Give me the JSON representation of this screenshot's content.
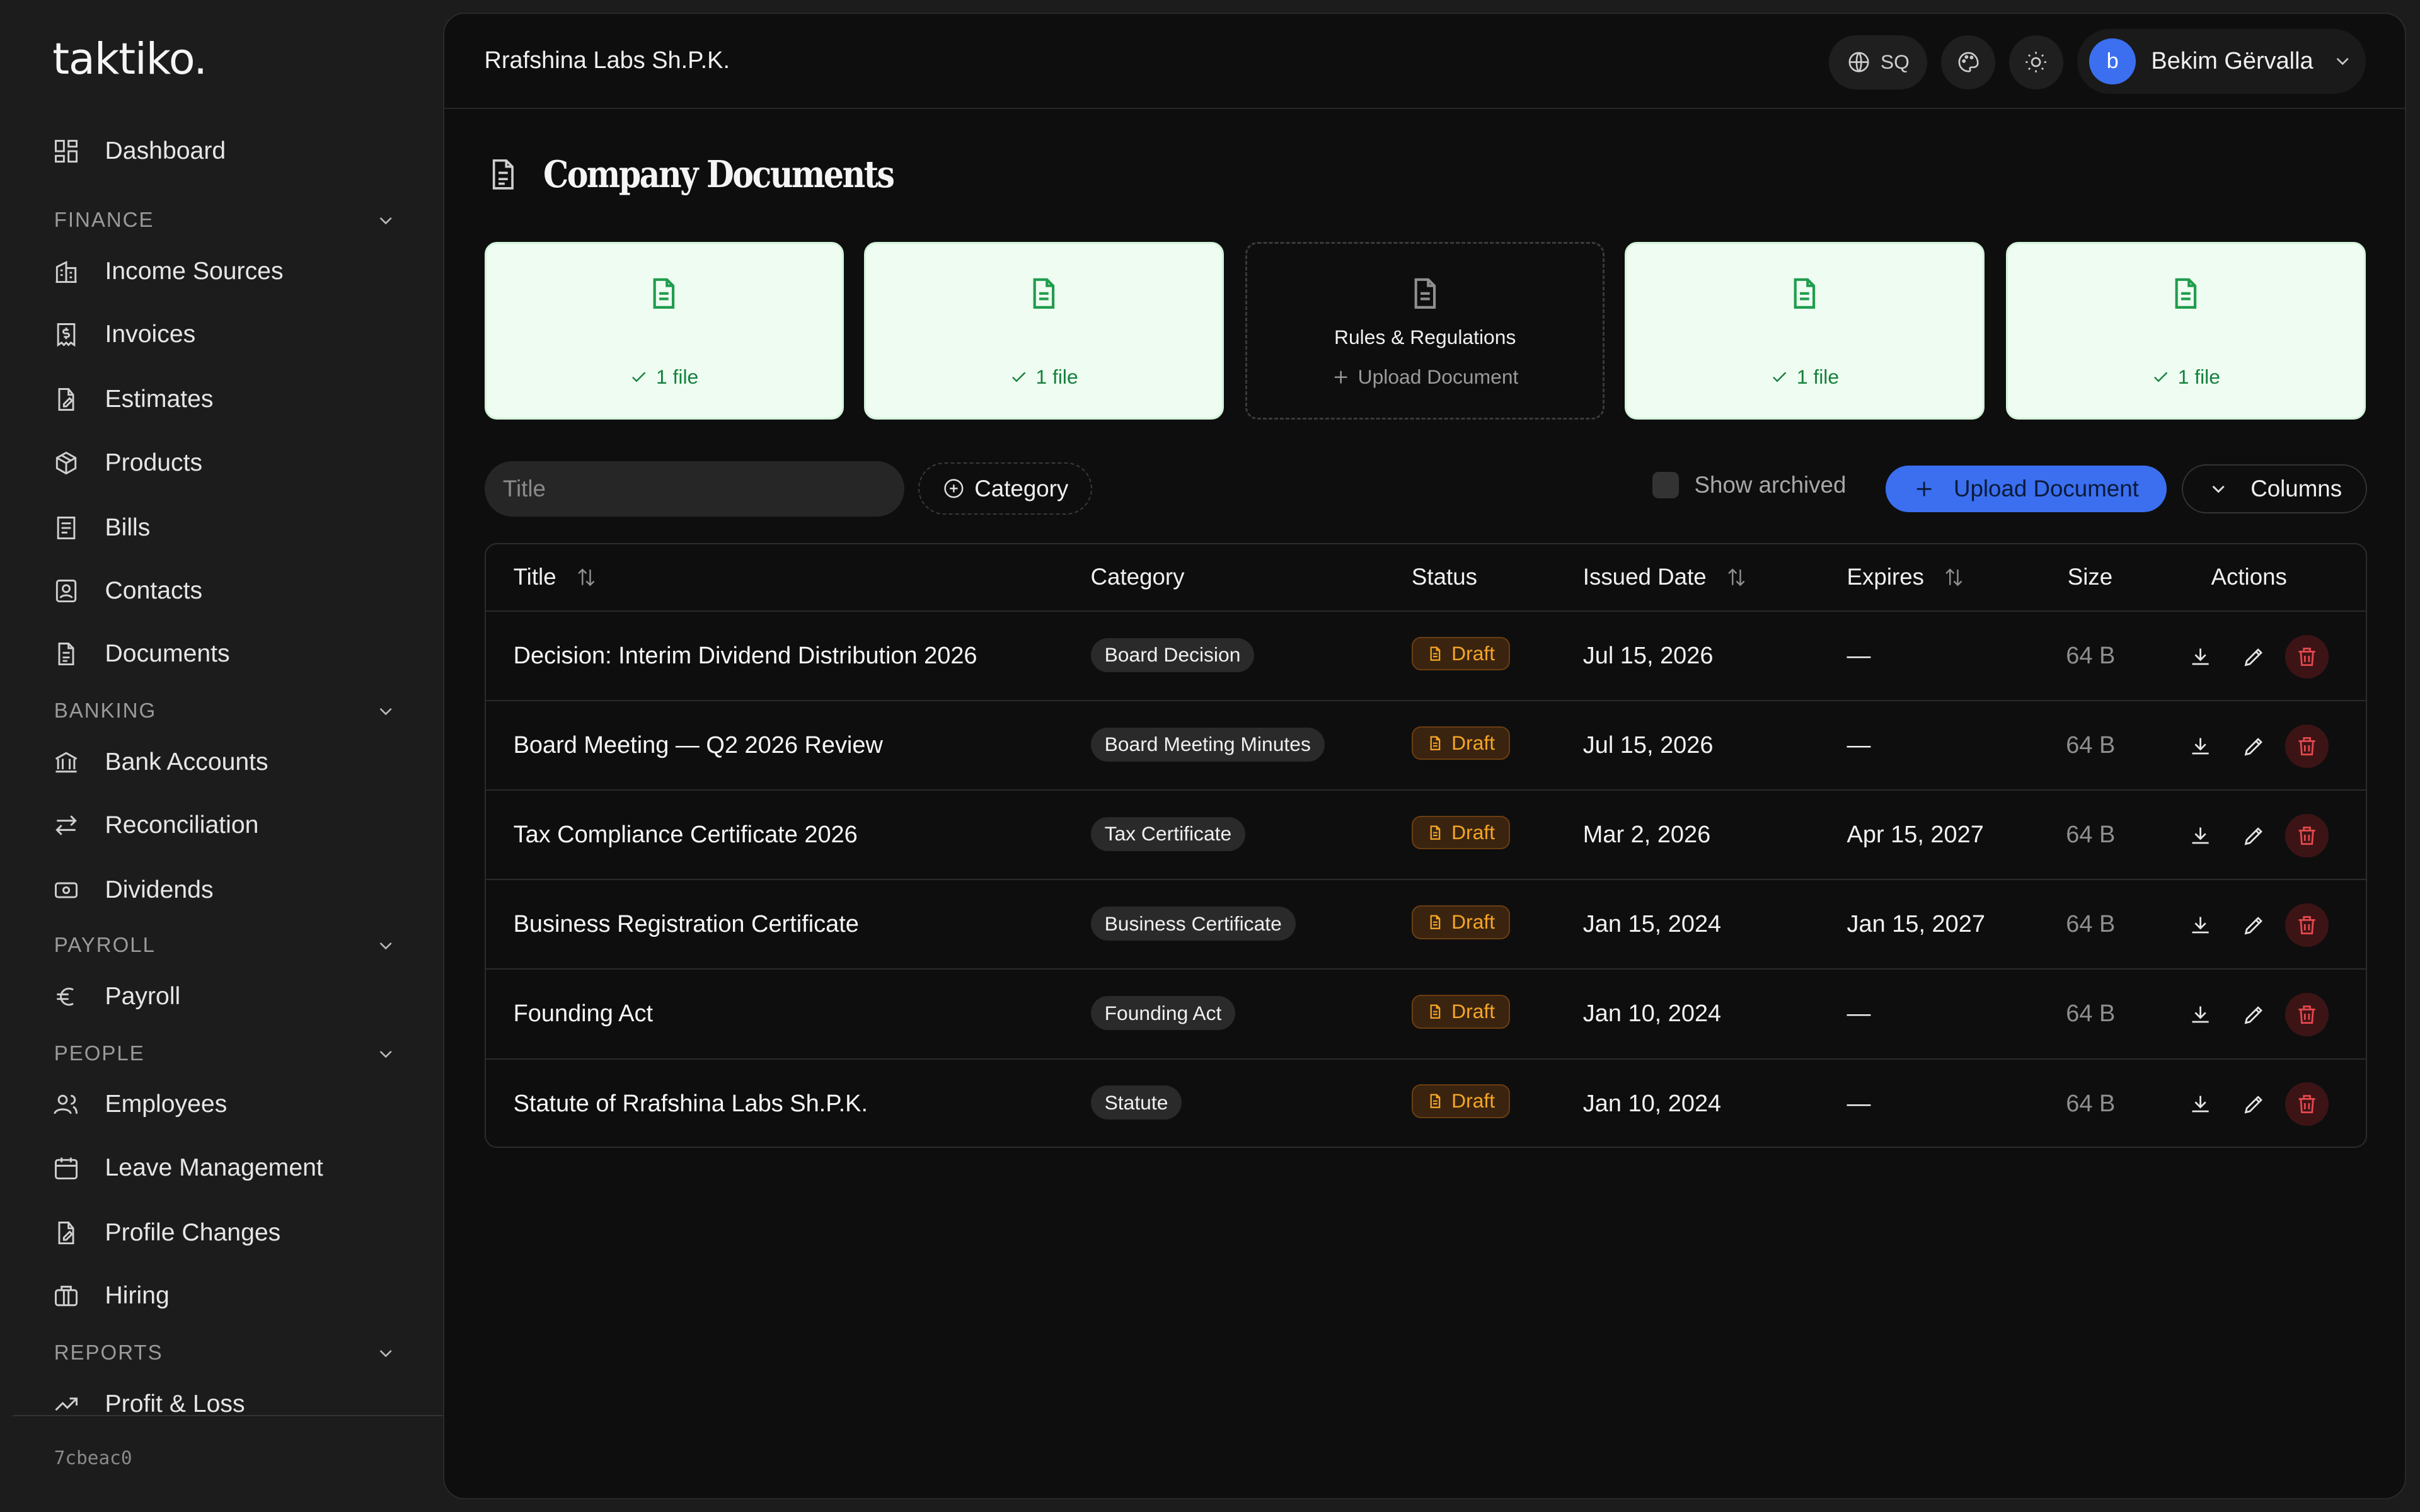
{
  "app": {
    "logo": "taktiko.",
    "build": "7cbeac0"
  },
  "sidebar": {
    "dashboard": "Dashboard",
    "sections": [
      {
        "label": "FINANCE"
      },
      {
        "label": "BANKING"
      },
      {
        "label": "PAYROLL"
      },
      {
        "label": "PEOPLE"
      },
      {
        "label": "REPORTS"
      }
    ],
    "items": {
      "income_sources": "Income Sources",
      "invoices": "Invoices",
      "estimates": "Estimates",
      "products": "Products",
      "bills": "Bills",
      "contacts": "Contacts",
      "documents": "Documents",
      "bank_accounts": "Bank Accounts",
      "reconciliation": "Reconciliation",
      "dividends": "Dividends",
      "payroll": "Payroll",
      "employees": "Employees",
      "leave_management": "Leave Management",
      "profile_changes": "Profile Changes",
      "hiring": "Hiring",
      "profit_loss": "Profit & Loss"
    }
  },
  "header": {
    "company": "Rrafshina Labs Sh.P.K.",
    "language": "SQ",
    "user_initial": "b",
    "user_name": "Bekim Gërvalla"
  },
  "page": {
    "title": "Company Documents"
  },
  "cards": [
    {
      "name": "",
      "files": "1 file",
      "uploaded": true
    },
    {
      "name": "",
      "files": "1 file",
      "uploaded": true
    },
    {
      "name": "Rules & Regulations",
      "files": "Upload Document",
      "uploaded": false
    },
    {
      "name": "",
      "files": "1 file",
      "uploaded": true
    },
    {
      "name": "",
      "files": "1 file",
      "uploaded": true
    }
  ],
  "toolbar": {
    "search_placeholder": "Title",
    "category_filter": "Category",
    "show_archived": "Show archived",
    "upload": "Upload Document",
    "columns": "Columns"
  },
  "table": {
    "headers": {
      "title": "Title",
      "category": "Category",
      "status": "Status",
      "issued": "Issued Date",
      "expires": "Expires",
      "size": "Size",
      "actions": "Actions"
    },
    "rows": [
      {
        "title": "Decision: Interim Dividend Distribution 2026",
        "category": "Board Decision",
        "status": "Draft",
        "issued": "Jul 15, 2026",
        "expires": "—",
        "size": "64 B"
      },
      {
        "title": "Board Meeting — Q2 2026 Review",
        "category": "Board Meeting Minutes",
        "status": "Draft",
        "issued": "Jul 15, 2026",
        "expires": "—",
        "size": "64 B"
      },
      {
        "title": "Tax Compliance Certificate 2026",
        "category": "Tax Certificate",
        "status": "Draft",
        "issued": "Mar 2, 2026",
        "expires": "Apr 15, 2027",
        "size": "64 B"
      },
      {
        "title": "Business Registration Certificate",
        "category": "Business Certificate",
        "status": "Draft",
        "issued": "Jan 15, 2024",
        "expires": "Jan 15, 2027",
        "size": "64 B"
      },
      {
        "title": "Founding Act",
        "category": "Founding Act",
        "status": "Draft",
        "issued": "Jan 10, 2024",
        "expires": "—",
        "size": "64 B"
      },
      {
        "title": "Statute of Rrafshina Labs Sh.P.K.",
        "category": "Statute",
        "status": "Draft",
        "issued": "Jan 10, 2024",
        "expires": "—",
        "size": "64 B"
      }
    ]
  },
  "colors": {
    "accent": "#3b6ff0",
    "success": "#15803d",
    "warning": "#f5a524",
    "danger": "#e5484d"
  }
}
